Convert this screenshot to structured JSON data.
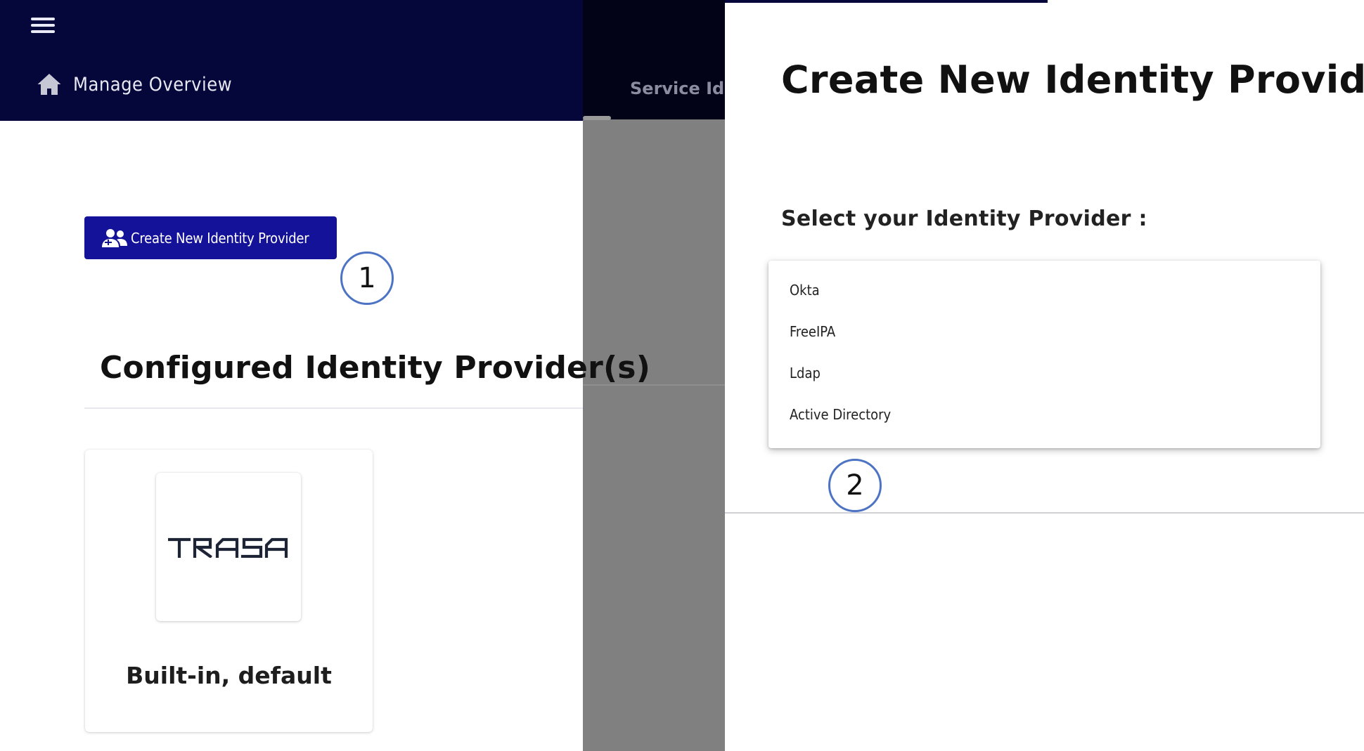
{
  "appbar": {
    "breadcrumb_label": "Manage Overview"
  },
  "background_tab": {
    "label": "Service Identity Providers"
  },
  "main": {
    "create_button_label": "Create New Identity Provider",
    "section_title": "Configured Identity Provider(s)",
    "providers": [
      {
        "logo_text": "TRASA",
        "name": "Built-in, default"
      }
    ]
  },
  "modal": {
    "title": "Create New Identity Provider",
    "select_label": "Select your Identity Provider :",
    "options": [
      "Okta",
      "FreeIPA",
      "Ldap",
      "Active Directory"
    ]
  },
  "annotations": {
    "step_1": "1",
    "step_2": "2"
  },
  "icons": {
    "menu": "hamburger-menu-icon",
    "breadcrumb": "home-icon",
    "create_button": "add-users-icon"
  },
  "colors": {
    "appbar_bg": "#05063a",
    "primary_button": "#15129a",
    "overlay": "#808080",
    "step_ring": "#4d74c4"
  }
}
